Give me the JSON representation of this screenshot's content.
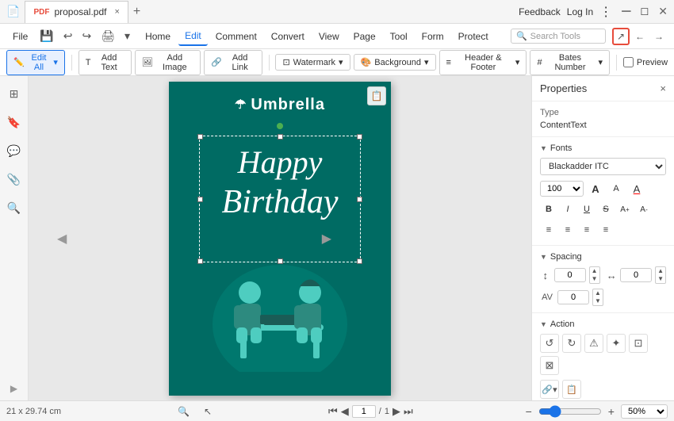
{
  "titlebar": {
    "tab_filename": "proposal.pdf",
    "close_tab": "×",
    "new_tab": "+",
    "feedback": "Feedback",
    "login": "Log In"
  },
  "menubar": {
    "undo_icon": "↩",
    "redo_icon": "↪",
    "items": [
      {
        "label": "Home",
        "active": false
      },
      {
        "label": "Edit",
        "active": true
      },
      {
        "label": "Comment",
        "active": false
      },
      {
        "label": "Convert",
        "active": false
      },
      {
        "label": "View",
        "active": false
      },
      {
        "label": "Page",
        "active": false
      },
      {
        "label": "Tool",
        "active": false
      },
      {
        "label": "Form",
        "active": false
      },
      {
        "label": "Protect",
        "active": false
      }
    ],
    "search_placeholder": "Search Tools",
    "file_label": "File"
  },
  "toolbar": {
    "edit_all": "Edit All",
    "edit_all_arrow": "▾",
    "add_text": "Add Text",
    "add_image": "Add Image",
    "add_link": "Add Link",
    "watermark": "Watermark",
    "watermark_arrow": "▾",
    "background": "Background",
    "background_arrow": "▾",
    "header_footer": "Header & Footer",
    "header_footer_arrow": "▾",
    "bates_number": "Bates Number",
    "bates_number_arrow": "▾",
    "preview": "Preview"
  },
  "properties_panel": {
    "title": "Properties",
    "close": "×",
    "type_label": "Type",
    "type_value": "ContentText",
    "fonts_label": "Fonts",
    "font_family": "Blackadder ITC",
    "font_size": "100",
    "bold": "B",
    "italic": "I",
    "underline": "U",
    "strikethrough": "S",
    "superscript": "A",
    "subscript": "A",
    "align_left": "≡",
    "align_center": "≡",
    "align_right": "≡",
    "align_justify": "≡",
    "spacing_label": "Spacing",
    "spacing_val1": "0",
    "spacing_val2": "0",
    "spacing_val3": "0",
    "action_label": "Action"
  },
  "pdf": {
    "brand": "Umbrella",
    "happy": "Happy",
    "birthday": "Birthday"
  },
  "statusbar": {
    "dimensions": "21 x 29.74 cm",
    "page_current": "1",
    "page_total": "1",
    "zoom": "50%"
  }
}
